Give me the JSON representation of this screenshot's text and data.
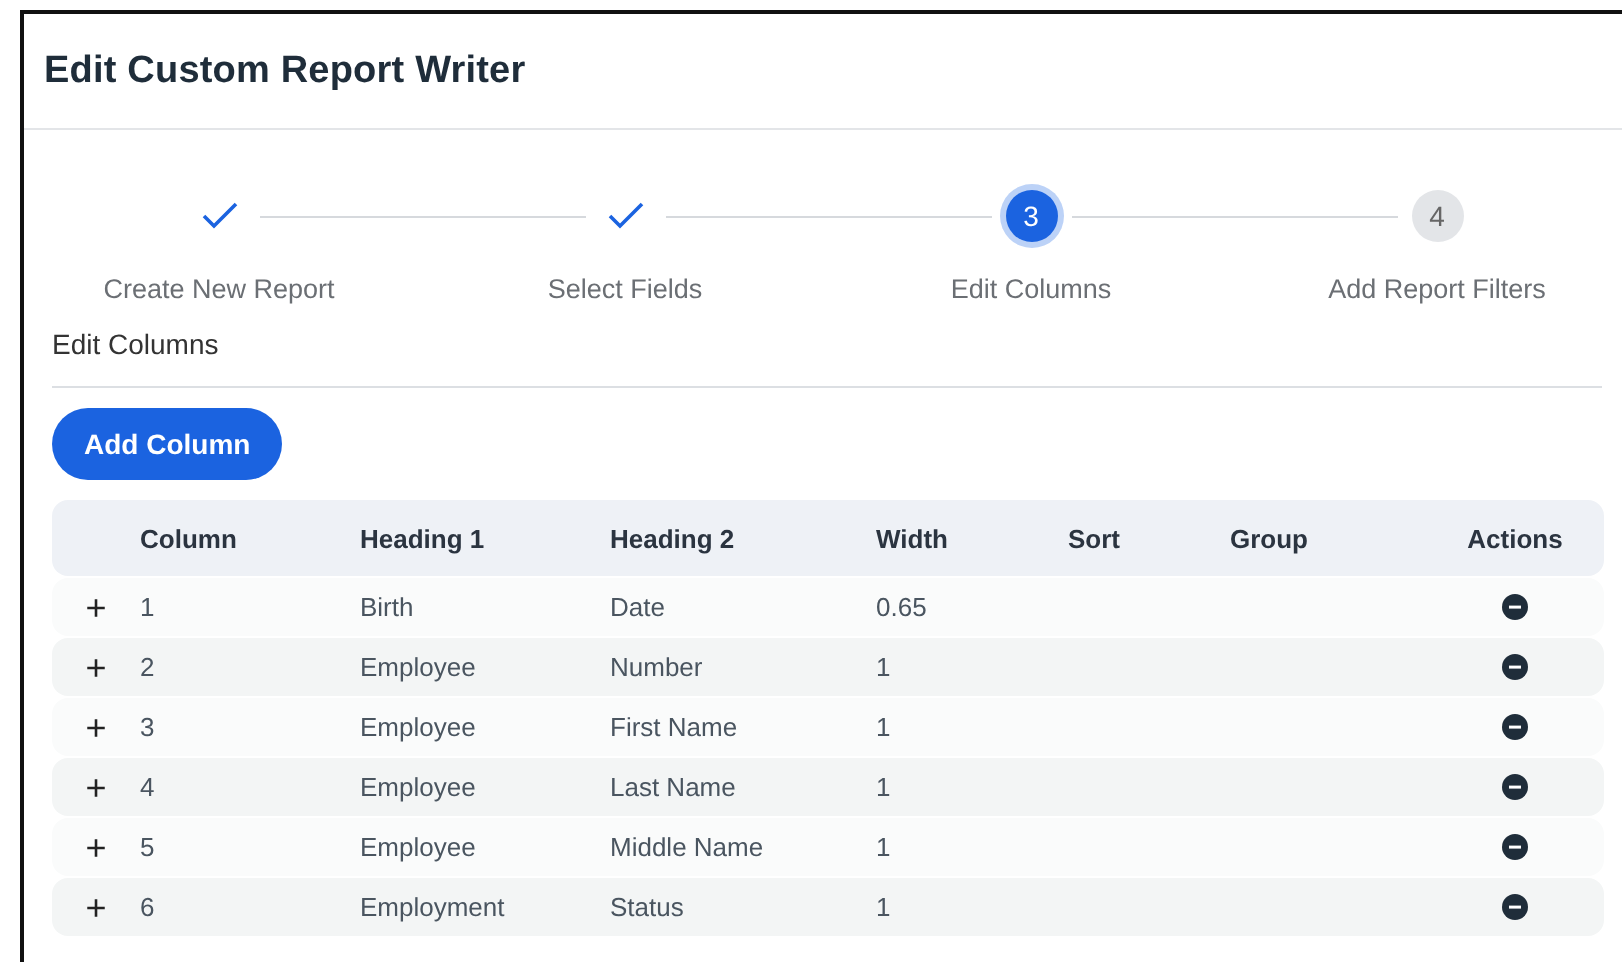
{
  "dialog": {
    "title": "Edit Custom Report Writer"
  },
  "steps": [
    {
      "label": "Create New Report",
      "kind": "done"
    },
    {
      "label": "Select Fields",
      "kind": "done"
    },
    {
      "label": "Edit Columns",
      "kind": "current",
      "number": "3"
    },
    {
      "label": "Add Report Filters",
      "kind": "pending",
      "number": "4"
    }
  ],
  "section_title": "Edit Columns",
  "add_button": "Add Column",
  "table": {
    "columns": [
      "Column",
      "Heading 1",
      "Heading 2",
      "Width",
      "Sort",
      "Group",
      "Actions"
    ],
    "rows": [
      {
        "expand": "+",
        "cells": [
          "1",
          "Birth",
          "Date",
          "0.65"
        ]
      },
      {
        "expand": "+",
        "cells": [
          "2",
          "Employee",
          "Number",
          "1"
        ]
      },
      {
        "expand": "+",
        "cells": [
          "3",
          "Employee",
          "First Name",
          "1"
        ]
      },
      {
        "expand": "+",
        "cells": [
          "4",
          "Employee",
          "Last Name",
          "1"
        ]
      },
      {
        "expand": "+",
        "cells": [
          "5",
          "Employee",
          "Middle Name",
          "1"
        ]
      },
      {
        "expand": "+",
        "cells": [
          "6",
          "Employment",
          "Status",
          "1"
        ]
      }
    ]
  }
}
